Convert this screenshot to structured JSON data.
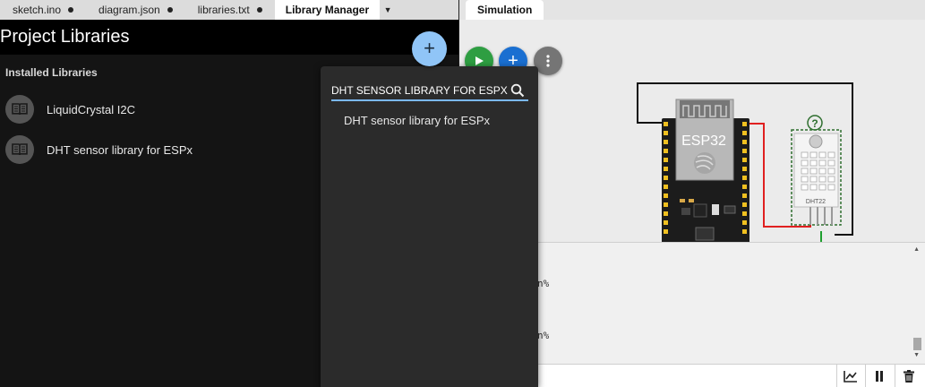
{
  "editor": {
    "tabs": [
      {
        "label": "sketch.ino",
        "modified": true
      },
      {
        "label": "diagram.json",
        "modified": true
      },
      {
        "label": "libraries.txt",
        "modified": true
      },
      {
        "label": "Library Manager",
        "active": true
      }
    ],
    "dropdown_icon": "caret-down-icon"
  },
  "library_manager": {
    "title": "Project Libraries",
    "add_button_label": "+",
    "installed_label": "Installed Libraries",
    "libraries": [
      {
        "name": "LiquidCrystal I2C",
        "icon": "book-icon"
      },
      {
        "name": "DHT sensor library for ESPx",
        "icon": "book-icon"
      }
    ]
  },
  "search": {
    "value": "DHT SENSOR LIBRARY FOR ESPX",
    "suggestions": [
      "DHT sensor library for ESPx"
    ],
    "icon": "search-icon"
  },
  "simulation": {
    "tab_label": "Simulation",
    "buttons": [
      "play-icon",
      "plus-icon",
      "more-vertical-icon"
    ],
    "board_label": "ESP32",
    "sensor_label": "DHT22",
    "sensor_status": "?"
  },
  "serial_monitor": {
    "lines": [
      "n%",
      "n%"
    ],
    "buttons": [
      "chart-icon",
      "pause-icon",
      "trash-icon"
    ]
  },
  "colors": {
    "accent_blue": "#1a6fd1",
    "play_green": "#2e9e42",
    "fab_light_blue": "#90c5f7",
    "wire_red": "#e02020",
    "wire_green": "#1e9e2e"
  }
}
